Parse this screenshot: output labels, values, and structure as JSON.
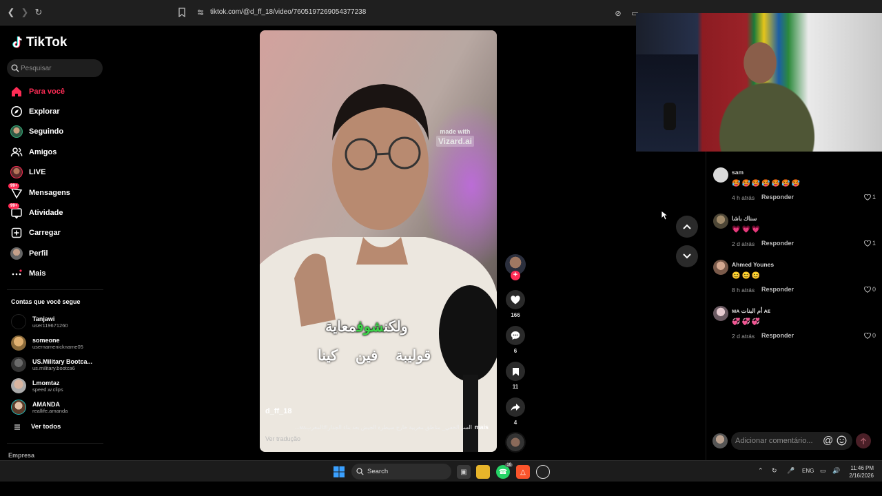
{
  "browser": {
    "url": "tiktok.com/@d_ff_18/video/7605197269054377238"
  },
  "sidebar": {
    "brand": "TikTok",
    "search_placeholder": "Pesquisar",
    "menu": [
      {
        "label": "Para você",
        "icon": "home-icon",
        "active": true
      },
      {
        "label": "Explorar",
        "icon": "compass-icon"
      },
      {
        "label": "Seguindo",
        "icon": "following-avatar-icon"
      },
      {
        "label": "Amigos",
        "icon": "friends-icon"
      },
      {
        "label": "LIVE",
        "icon": "live-icon"
      },
      {
        "label": "Mensagens",
        "icon": "messages-icon",
        "badge": "99+"
      },
      {
        "label": "Atividade",
        "icon": "activity-icon",
        "badge": "99+"
      },
      {
        "label": "Carregar",
        "icon": "upload-icon"
      },
      {
        "label": "Perfil",
        "icon": "profile-avatar-icon"
      },
      {
        "label": "Mais",
        "icon": "more-icon"
      }
    ],
    "following_title": "Contas que você segue",
    "following": [
      {
        "name": "Tanjawi",
        "username": "user119671260"
      },
      {
        "name": "someone",
        "username": "usernamenickname05"
      },
      {
        "name": "US.Military Bootca...",
        "username": "us.military.bootca6"
      },
      {
        "name": "Lmomtaz",
        "username": "speed.w.clips"
      },
      {
        "name": "AMANDA",
        "username": "reallife.amanda"
      }
    ],
    "see_all": "Ver todos",
    "footer_label": "Empresa"
  },
  "video": {
    "watermark_line1": "made with",
    "watermark_line2": "Vizard.ai",
    "subtitle_line1_a": "ولكن",
    "subtitle_line1_highlight": "شوف",
    "subtitle_line1_b": "معاية",
    "subtitle_line2": "قوليبة فين كينا",
    "username": "d_ff_18",
    "description": "السر الخفي_ مناطق مغربية خارج سيطرة الجيش بعد بناء الجدار!#المغربᴍᴀ...",
    "more": "mais",
    "translate": "Ver tradução"
  },
  "actions": {
    "likes": "166",
    "comments": "6",
    "saves": "11",
    "shares": "4"
  },
  "comments": [
    {
      "name": "sam",
      "text": "🥵🥵🥵🥵🥵🥵🥵",
      "time": "4 h atrás",
      "reply": "Responder",
      "likes": "1",
      "avatar_color": "#d9d9d9"
    },
    {
      "name": "سناك باشا",
      "text": "💗💗💗",
      "time": "2 d atrás",
      "reply": "Responder",
      "likes": "1",
      "avatar_color": "#7a6a52"
    },
    {
      "name": "Ahmed Younes",
      "text": "😊😊😊",
      "time": "8 h atrás",
      "reply": "Responder",
      "likes": "0",
      "avatar_color": "#b98a74"
    },
    {
      "name": "ᴍᴀ أم البنات ᴀᴇ",
      "text": "💞💞💞",
      "time": "2 d atrás",
      "reply": "Responder",
      "likes": "0",
      "avatar_color": "#c7a9b0"
    }
  ],
  "comment_input": {
    "placeholder": "Adicionar comentário..."
  },
  "taskbar": {
    "search_label": "Search",
    "whatsapp_badge": "16",
    "lang": "ENG",
    "time": "11:46 PM",
    "date": "2/16/2026"
  },
  "colors": {
    "accent": "#fe2c55",
    "subtitle_highlight": "#3ed34a"
  }
}
